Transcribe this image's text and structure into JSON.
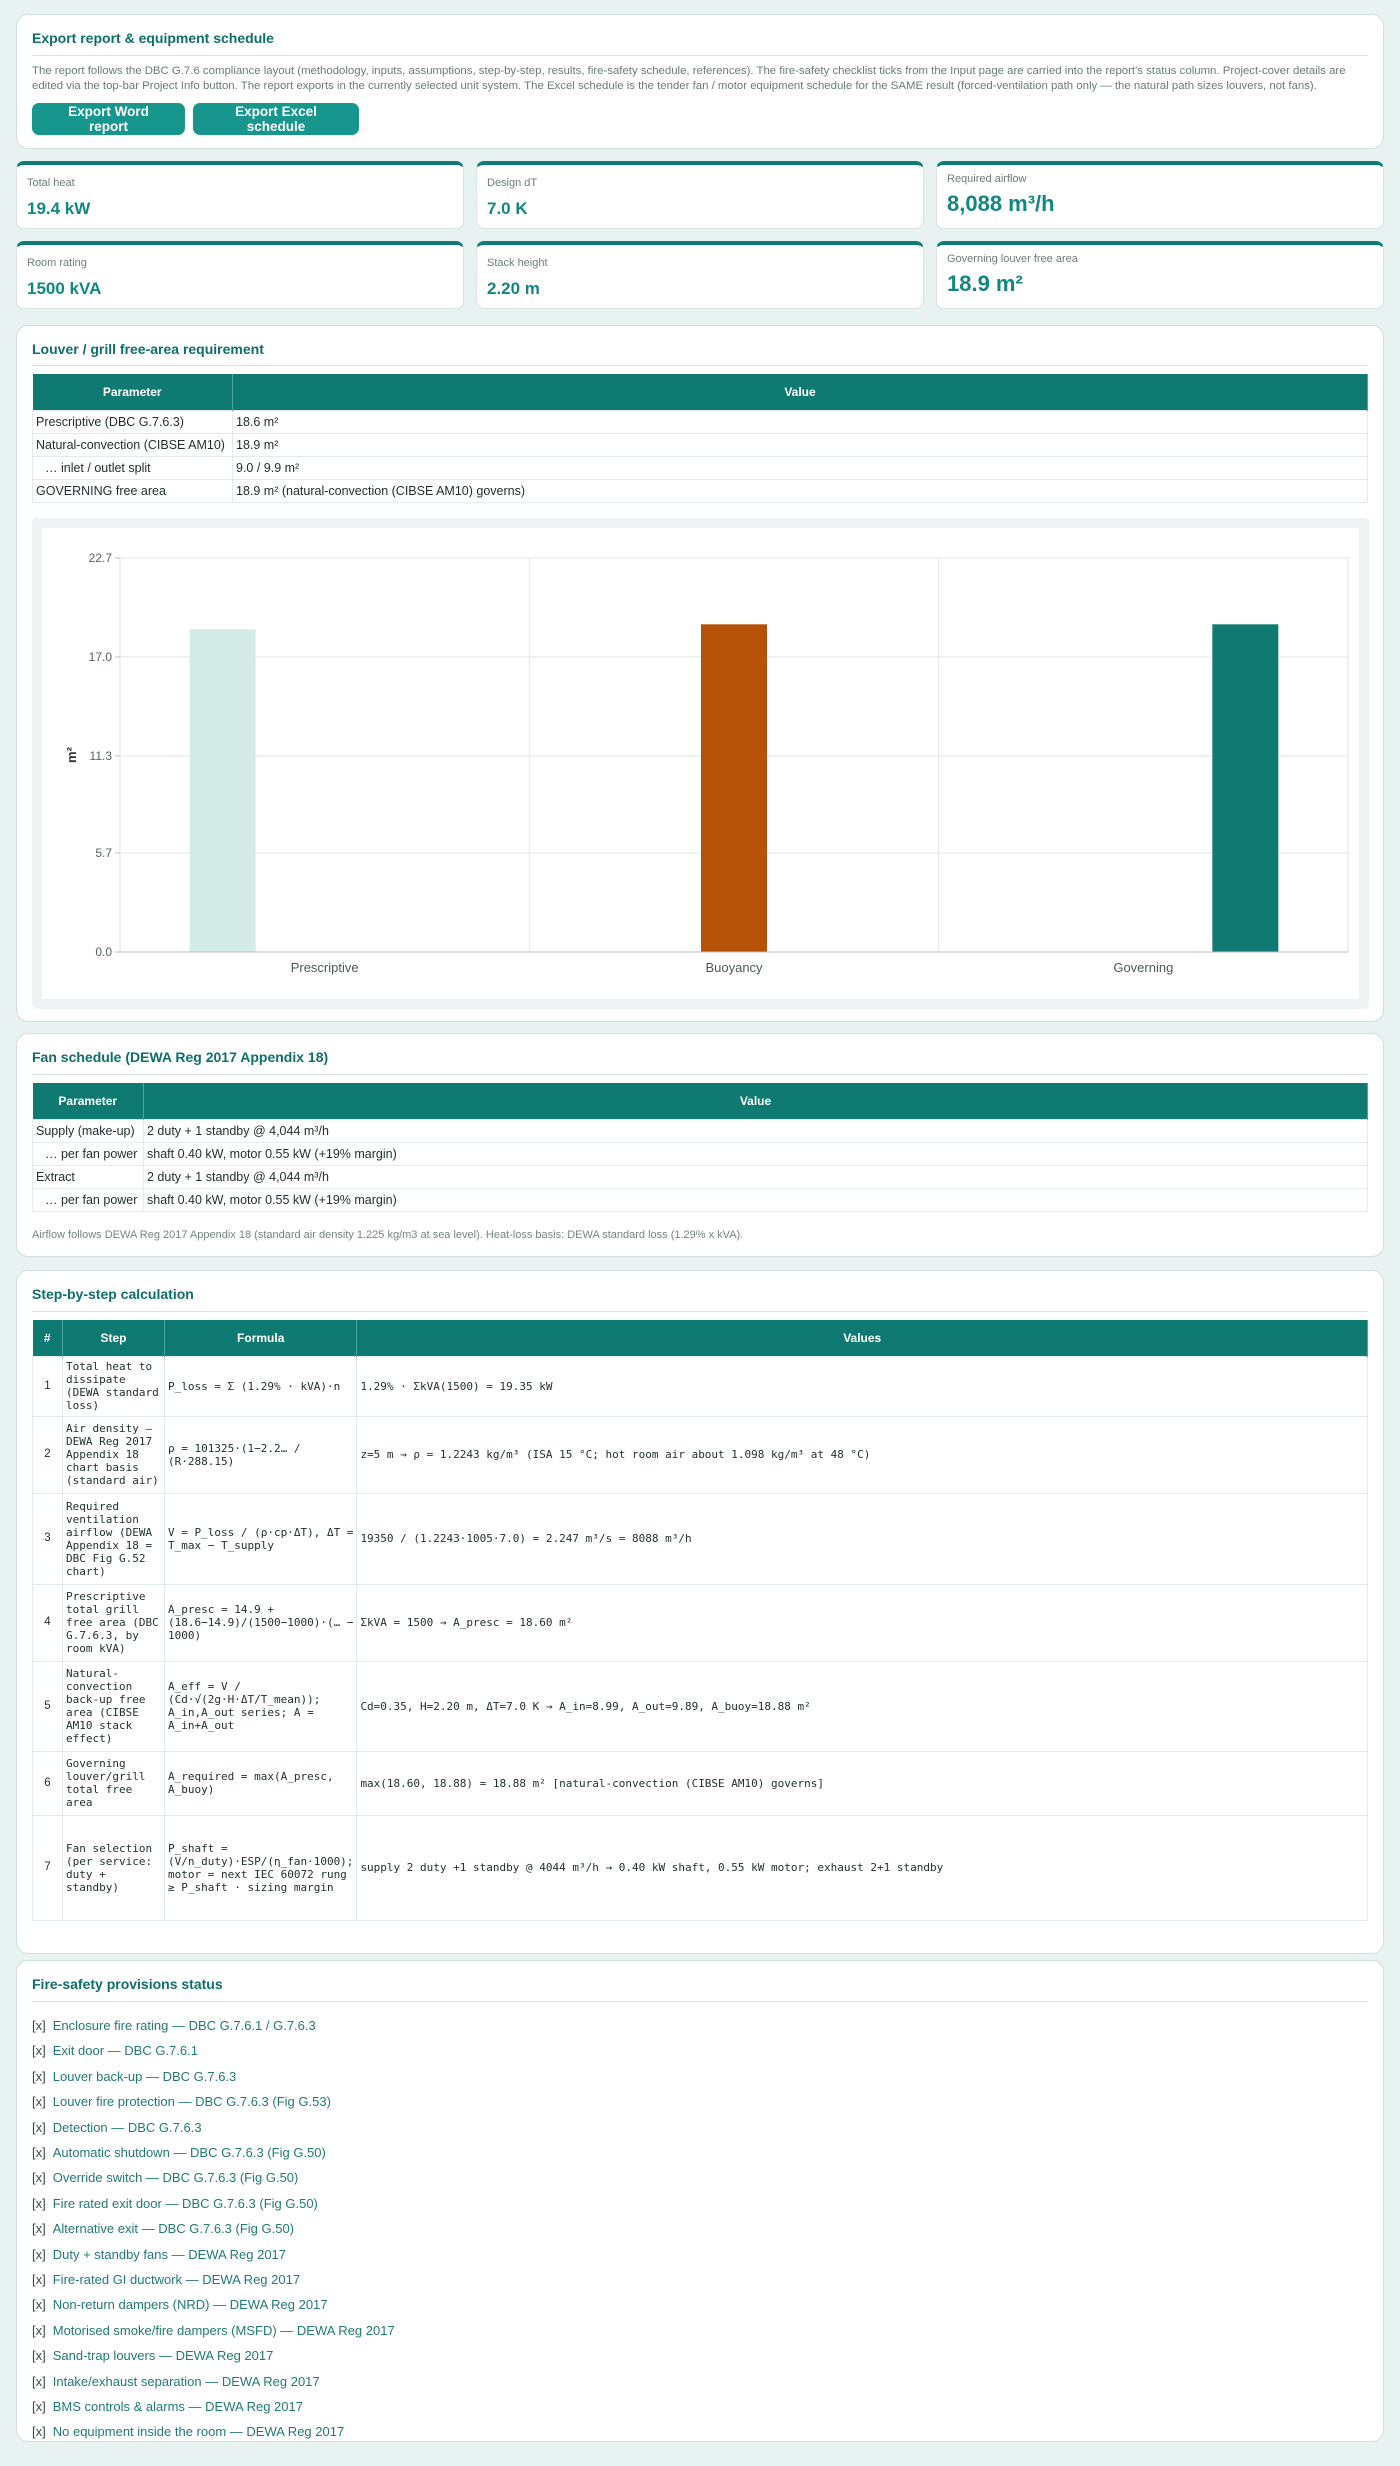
{
  "export": {
    "title": "Export report & equipment schedule",
    "description": "The report follows the DBC G.7.6 compliance layout (methodology, inputs, assumptions, step-by-step, results, fire-safety schedule, references). The fire-safety checklist ticks from the Input page are carried into the report's status column. Project-cover details are edited via the top-bar Project Info button. The report exports in the currently selected unit system. The Excel schedule is the tender fan / motor equipment schedule for the SAME result (forced-ventilation path only — the natural path sizes louvers, not fans).",
    "word_button": "Export Word report",
    "excel_button": "Export Excel schedule"
  },
  "metrics": {
    "total_heat_label": "Total heat",
    "total_heat_value": "19.4 kW",
    "design_dt_label": "Design dT",
    "design_dt_value": "7.0 K",
    "airflow_label": "Required airflow",
    "airflow_value": "8,088 m³/h",
    "room_rating_label": "Room rating",
    "room_rating_value": "1500 kVA",
    "stack_label": "Stack height",
    "stack_value": "2.20 m",
    "louver_label": "Governing louver free area",
    "louver_value": "18.9 m²"
  },
  "louver": {
    "title": "Louver / grill free-area requirement",
    "col_param": "Parameter",
    "col_value": "Value",
    "rows": [
      {
        "param": "Prescriptive (DBC G.7.6.3)",
        "value": "18.6 m²"
      },
      {
        "param": "Natural-convection (CIBSE AM10)",
        "value": "18.9 m²"
      },
      {
        "param": "… inlet / outlet split",
        "value": "9.0 / 9.9 m²"
      },
      {
        "param": "GOVERNING free area",
        "value": "18.9 m²  (natural-convection (CIBSE AM10) governs)"
      }
    ]
  },
  "chart_data": {
    "type": "bar",
    "categories": [
      "Prescriptive",
      "Buoyancy",
      "Governing"
    ],
    "values": [
      18.6,
      18.88,
      18.88
    ],
    "colors": [
      "#d4ebe8",
      "#b65208",
      "#107a72"
    ],
    "ylabel": "m²",
    "ylim": [
      0,
      22.7
    ],
    "yticks": [
      "0.0",
      "5.7",
      "11.3",
      "17.0",
      "22.7"
    ],
    "grid": true
  },
  "fans": {
    "title": "Fan schedule (DEWA Reg 2017 Appendix 18)",
    "col_param": "Parameter",
    "col_value": "Value",
    "rows": [
      {
        "param": "Supply (make-up)",
        "value": "2 duty + 1 standby @ 4,044 m³/h"
      },
      {
        "param": "… per fan power",
        "value": "shaft 0.40 kW, motor 0.55 kW (+19% margin)"
      },
      {
        "param": "Extract",
        "value": "2 duty + 1 standby @ 4,044 m³/h"
      },
      {
        "param": "… per fan power",
        "value": "shaft 0.40 kW, motor 0.55 kW (+19% margin)"
      }
    ],
    "note": "Airflow follows DEWA Reg 2017 Appendix 18 (standard air density 1.225 kg/m3 at sea level). Heat-loss basis: DEWA standard loss (1.29% x kVA)."
  },
  "steps": {
    "title": "Step-by-step calculation",
    "col_num": "#",
    "col_step": "Step",
    "col_formula": "Formula",
    "col_values": "Values",
    "rows": [
      {
        "num": "1",
        "step": "Total heat to dissipate (DEWA standard loss)",
        "formula": "P_loss = Σ (1.29% · kVA)·n",
        "values": "1.29% · ΣkVA(1500) = 19.35 kW"
      },
      {
        "num": "2",
        "step": "Air density — DEWA Reg 2017 Appendix 18 chart basis (standard air)",
        "formula": "ρ = 101325·(1−2.2… / (R·288.15)",
        "values": "z=5 m → ρ = 1.2243 kg/m³ (ISA 15 °C; hot room air about 1.098 kg/m³ at 48 °C)"
      },
      {
        "num": "3",
        "step": "Required ventilation airflow (DEWA Appendix 18 = DBC Fig G.52 chart)",
        "formula": "V = P_loss / (ρ·cp·ΔT),  ΔT = T_max − T_supply",
        "values": "19350 / (1.2243·1005·7.0) = 2.247 m³/s = 8088 m³/h"
      },
      {
        "num": "4",
        "step": "Prescriptive total grill free area (DBC G.7.6.3, by room kVA)",
        "formula": "A_presc = 14.9 + (18.6−14.9)/(1500−1000)·(… − 1000)",
        "values": "ΣkVA = 1500 → A_presc = 18.60 m²"
      },
      {
        "num": "5",
        "step": "Natural-convection back-up free area (CIBSE AM10 stack effect)",
        "formula": "A_eff = V / (Cd·√(2g·H·ΔT/T_mean)); A_in,A_out series; A = A_in+A_out",
        "values": "Cd=0.35, H=2.20 m, ΔT=7.0 K → A_in=8.99, A_out=9.89, A_buoy=18.88 m²"
      },
      {
        "num": "6",
        "step": "Governing louver/grill total free area",
        "formula": "A_required = max(A_presc, A_buoy)",
        "values": "max(18.60, 18.88) = 18.88 m²  [natural-convection (CIBSE AM10) governs]"
      },
      {
        "num": "7",
        "step": "Fan selection (per service: duty + standby)",
        "formula": "P_shaft = (V/n_duty)·ESP/(η_fan·1000); motor = next IEC 60072 rung ≥ P_shaft · sizing margin",
        "values": "supply 2 duty +1 standby @ 4044 m³/h → 0.40 kW shaft, 0.55 kW motor; exhaust 2+1 standby"
      }
    ]
  },
  "fire": {
    "title": "Fire-safety provisions status",
    "mark": "[x]",
    "items": [
      "Enclosure fire rating — DBC G.7.6.1 / G.7.6.3",
      "Exit door — DBC G.7.6.1",
      "Louver back-up — DBC G.7.6.3",
      "Louver fire protection — DBC G.7.6.3 (Fig G.53)",
      "Detection — DBC G.7.6.3",
      "Automatic shutdown — DBC G.7.6.3 (Fig G.50)",
      "Override switch — DBC G.7.6.3 (Fig G.50)",
      "Fire rated exit door — DBC G.7.6.3 (Fig G.50)",
      "Alternative exit — DBC G.7.6.3 (Fig G.50)",
      "Duty + standby fans — DEWA Reg 2017",
      "Fire-rated GI ductwork — DEWA Reg 2017",
      "Non-return dampers (NRD) — DEWA Reg 2017",
      "Motorised smoke/fire dampers (MSFD) — DEWA Reg 2017",
      "Sand-trap louvers — DEWA Reg 2017",
      "Intake/exhaust separation — DEWA Reg 2017",
      "BMS controls & alarms — DEWA Reg 2017",
      "No equipment inside the room — DEWA Reg 2017"
    ]
  }
}
